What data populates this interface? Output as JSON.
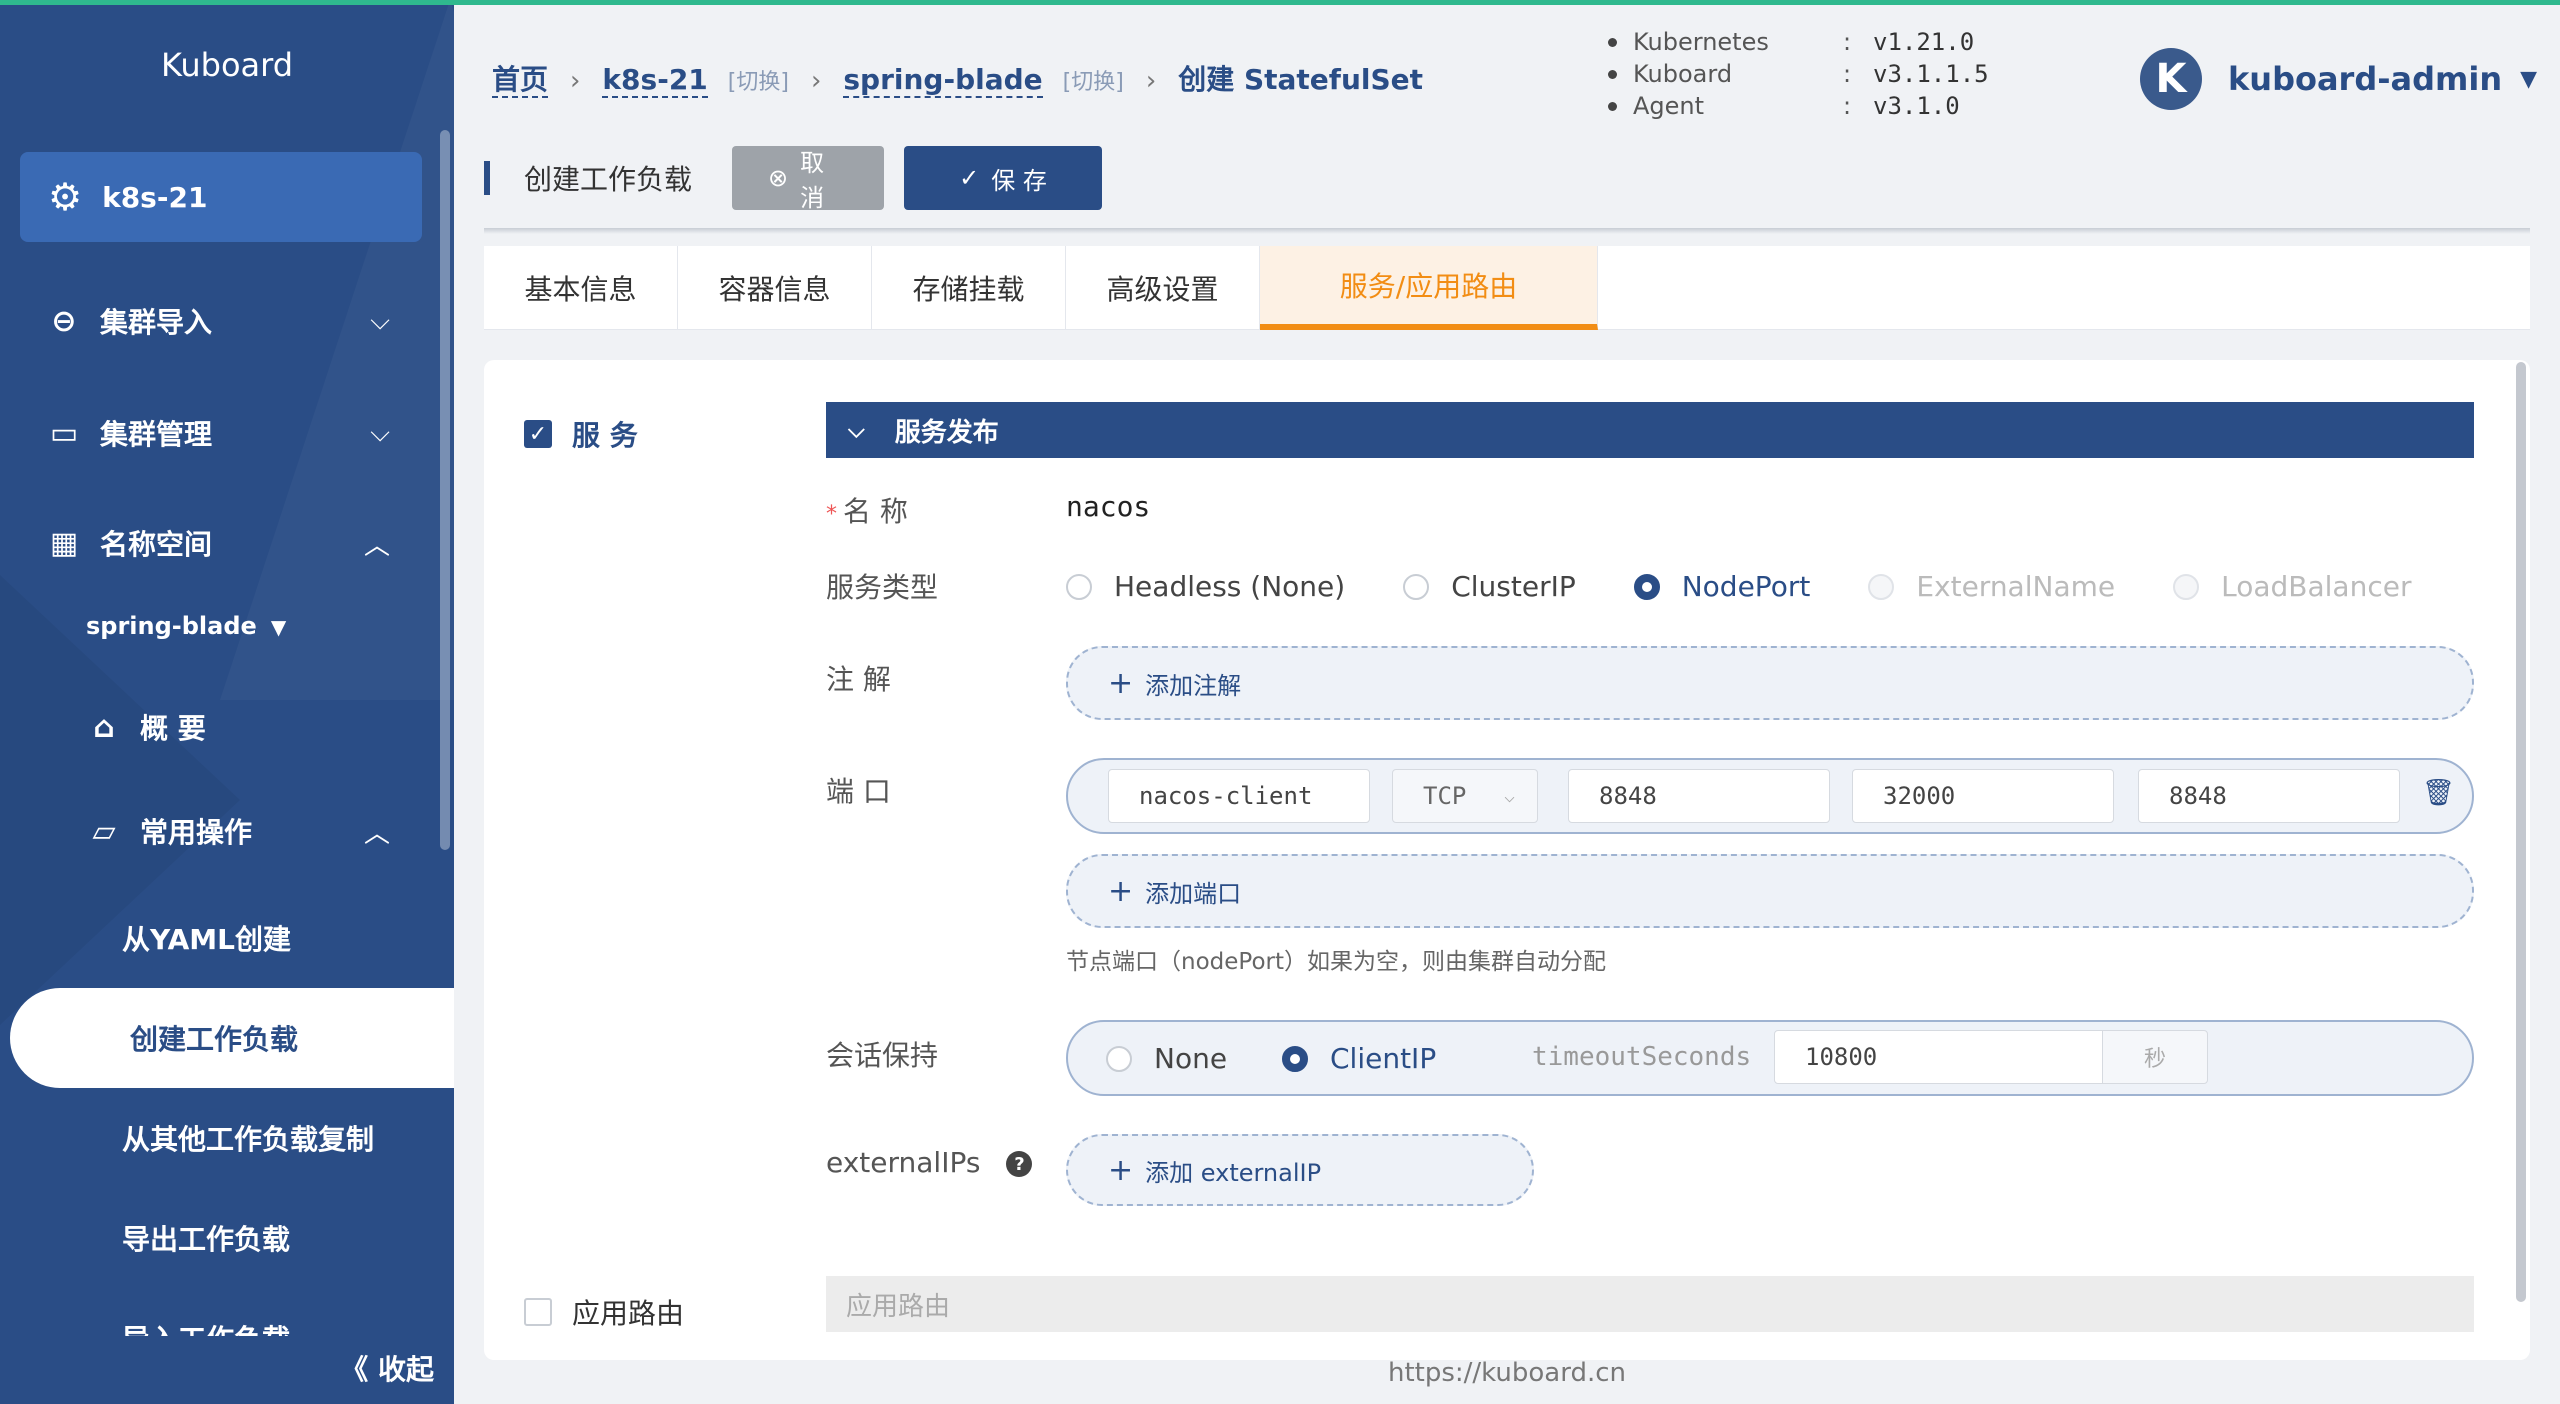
{
  "sidebar": {
    "logo": "Kuboard",
    "cluster": "k8s-21",
    "menu": {
      "cluster_import": "集群导入",
      "cluster_manage": "集群管理",
      "namespace": "名称空间"
    },
    "namespace_selected": "spring-blade",
    "overview": "概 要",
    "common_ops": "常用操作",
    "from_yaml": "从YAML创建",
    "create_workload": "创建工作负载",
    "copy_workload": "从其他工作负载复制",
    "export_workload": "导出工作负载",
    "import_workload_partial": "导入工作负载",
    "collapse": "收起"
  },
  "breadcrumb": {
    "home": "首页",
    "cluster": "k8s-21",
    "switch1": "[切换]",
    "namespace": "spring-blade",
    "switch2": "[切换]",
    "current": "创建 StatefulSet"
  },
  "versions": [
    {
      "name": "Kubernetes",
      "colon": ":",
      "value": "v1.21.0"
    },
    {
      "name": "Kuboard",
      "colon": ":",
      "value": "v3.1.1.5"
    },
    {
      "name": "Agent",
      "colon": ":",
      "value": "v3.1.0"
    }
  ],
  "user": {
    "avatar_letter": "K",
    "name": "kuboard-admin"
  },
  "toolbar": {
    "title": "创建工作负载",
    "cancel": "取 消",
    "save": "保 存"
  },
  "tabs": [
    "基本信息",
    "容器信息",
    "存储挂载",
    "高级设置",
    "服务/应用路由"
  ],
  "service": {
    "checkbox_label": "服 务",
    "section_title": "服务发布",
    "name_label": "名 称",
    "name_value": "nacos",
    "type_label": "服务类型",
    "types": [
      "Headless (None)",
      "ClusterIP",
      "NodePort",
      "ExternalName",
      "LoadBalancer"
    ],
    "type_selected": "NodePort",
    "annotation_label": "注 解",
    "add_annotation": "添加注解",
    "port_label": "端 口",
    "port": {
      "name": "nacos-client",
      "protocol": "TCP",
      "port": "8848",
      "node_port": "32000",
      "target_port": "8848"
    },
    "add_port": "添加端口",
    "node_port_hint": "节点端口（nodePort）如果为空，则由集群自动分配",
    "session_label": "会话保持",
    "session_options": [
      "None",
      "ClientIP"
    ],
    "session_selected": "ClientIP",
    "timeout_label": "timeoutSeconds",
    "timeout_value": "10800",
    "timeout_unit": "秒",
    "external_ips_label": "externalIPs",
    "help_glyph": "?",
    "add_external_ip": "添加 externalIP"
  },
  "route": {
    "checkbox_label": "应用路由",
    "placeholder": "应用路由"
  },
  "footer_url": "https://kuboard.cn",
  "colors": {
    "primary": "#2a4d86",
    "accent": "#f28d14",
    "top_line": "#2fb98e"
  }
}
